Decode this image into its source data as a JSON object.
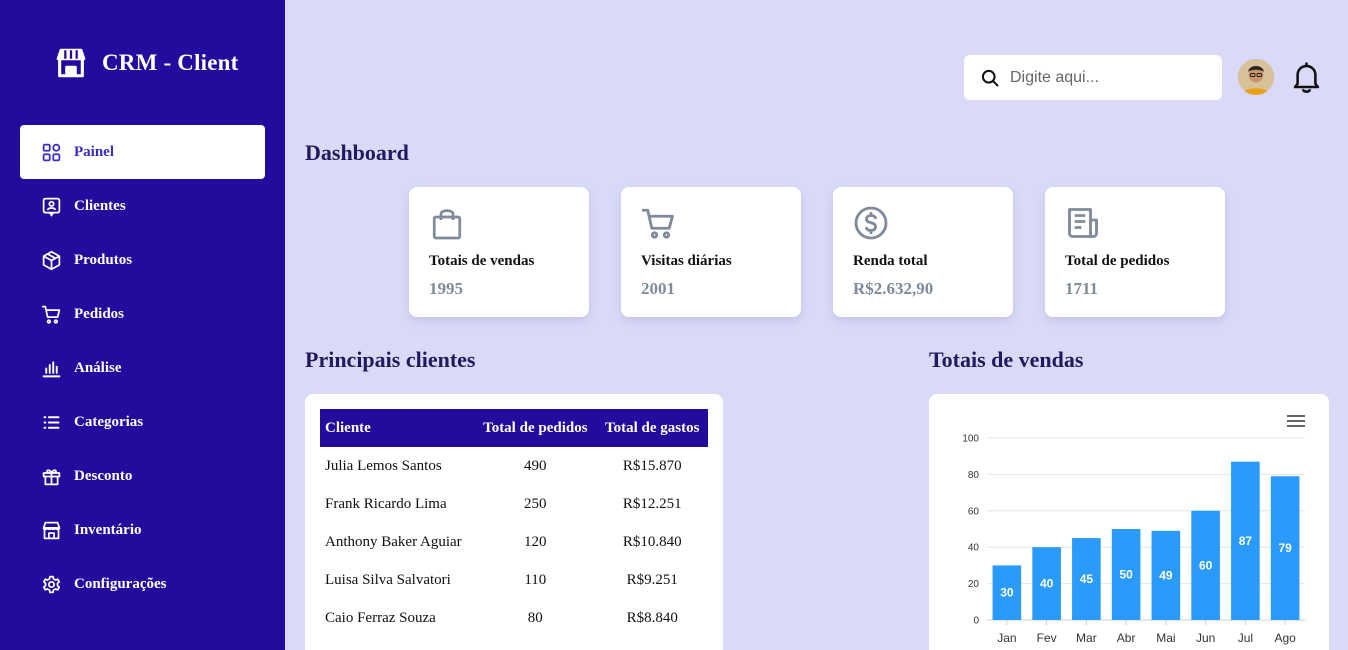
{
  "brand": {
    "title": "CRM - Client",
    "icon": "store-icon"
  },
  "sidebar": {
    "items": [
      {
        "label": "Painel",
        "icon": "grid-icon",
        "active": true
      },
      {
        "label": "Clientes",
        "icon": "user-card-icon"
      },
      {
        "label": "Produtos",
        "icon": "box-icon"
      },
      {
        "label": "Pedidos",
        "icon": "cart-icon"
      },
      {
        "label": "Análise",
        "icon": "bar-chart-icon"
      },
      {
        "label": "Categorias",
        "icon": "list-icon"
      },
      {
        "label": "Desconto",
        "icon": "gift-icon"
      },
      {
        "label": "Inventário",
        "icon": "warehouse-icon"
      },
      {
        "label": "Configurações",
        "icon": "gear-icon"
      }
    ]
  },
  "header": {
    "search_placeholder": "Digite aqui..."
  },
  "dashboard": {
    "title": "Dashboard",
    "cards": [
      {
        "label": "Totais de vendas",
        "value": "1995",
        "icon": "shopping-bag-icon"
      },
      {
        "label": "Visitas diárias",
        "value": "2001",
        "icon": "cart-icon"
      },
      {
        "label": "Renda total",
        "value": "R$2.632,90",
        "icon": "dollar-coin-icon"
      },
      {
        "label": "Total de pedidos",
        "value": "1711",
        "icon": "receipt-icon"
      }
    ]
  },
  "clients": {
    "title": "Principais clientes",
    "columns": [
      "Cliente",
      "Total de pedidos",
      "Total de gastos"
    ],
    "rows": [
      [
        "Julia Lemos Santos",
        "490",
        "R$15.870"
      ],
      [
        "Frank Ricardo Lima",
        "250",
        "R$12.251"
      ],
      [
        "Anthony Baker Aguiar",
        "120",
        "R$10.840"
      ],
      [
        "Luisa Silva Salvatori",
        "110",
        "R$9.251"
      ],
      [
        "Caio Ferraz Souza",
        "80",
        "R$8.840"
      ]
    ]
  },
  "sales": {
    "title": "Totais de vendas"
  },
  "colors": {
    "sidebar": "#230b9e",
    "background": "#dadaf8",
    "bar": "#2b9bfb",
    "card_value": "#7f8a9a"
  },
  "chart_data": {
    "type": "bar",
    "categories": [
      "Jan",
      "Fev",
      "Mar",
      "Abr",
      "Mai",
      "Jun",
      "Jul",
      "Ago"
    ],
    "values": [
      30,
      40,
      45,
      50,
      49,
      60,
      87,
      79
    ],
    "title": "",
    "xlabel": "",
    "ylabel": "",
    "ylim": [
      0,
      100
    ],
    "yticks": [
      0,
      20,
      40,
      60,
      80,
      100
    ],
    "grid": true,
    "data_labels": true
  }
}
